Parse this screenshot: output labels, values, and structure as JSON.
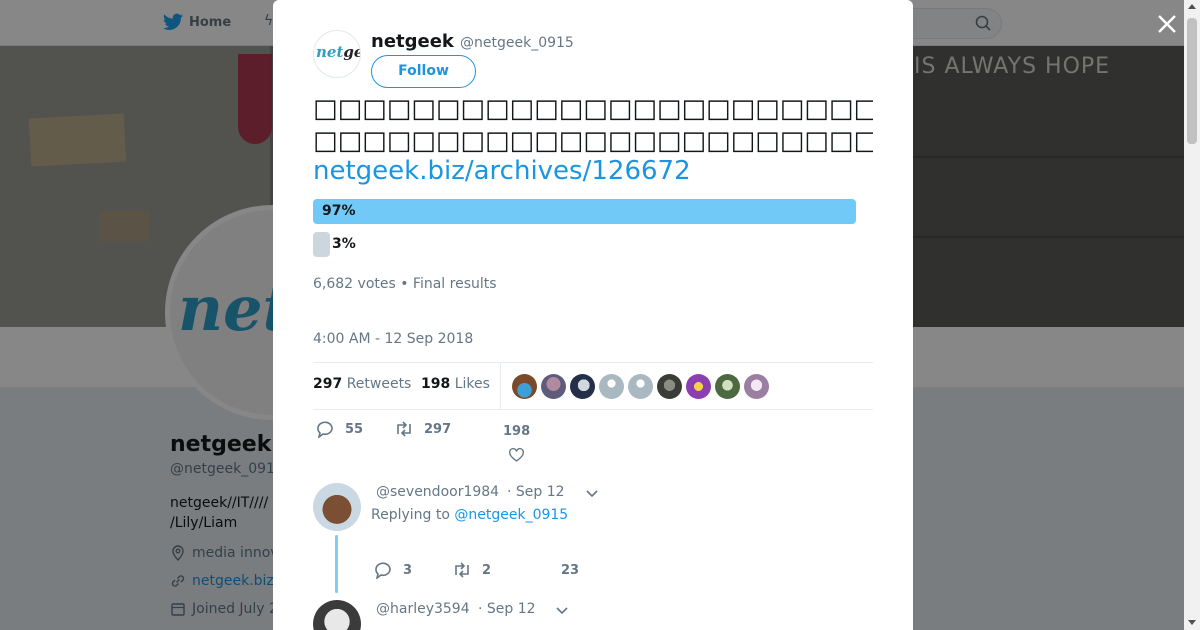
{
  "background": {
    "nav": {
      "home_label": "Home"
    },
    "banner_text": "IS ALWAYS HOPE",
    "profile": {
      "name": "netgeek",
      "handle": "@netgeek_091",
      "bio": "netgeek//IT//// /Lily/Liam",
      "location": "media innov",
      "website": "netgeek.biz",
      "joined": "Joined July 2"
    }
  },
  "tweet": {
    "author_name": "netgeek",
    "author_handle": "@netgeek_0915",
    "avatar_text": "netgeek",
    "follow_label": "Follow",
    "text_line1": "□□□□□□□□□□□□□□□□□□□□□□□",
    "text_line2": "□□□□□□□□□□□□□□□□□□□□□□□□□□□□□□□□□□",
    "link": "netgeek.biz/archives/126672",
    "poll": {
      "options": [
        {
          "label": "97%",
          "share": 0.97,
          "color": "#71c9f8"
        },
        {
          "label": "3%",
          "share": 0.03,
          "color": "#ccd6dd"
        }
      ],
      "meta": "6,682 votes • Final results"
    },
    "timestamp": "4:00 AM - 12 Sep 2018",
    "retweets_count": "297",
    "retweets_label": "Retweets",
    "likes_count": "198",
    "likes_label": "Likes",
    "actions": {
      "replies": "55",
      "retweets": "297",
      "likes": "198"
    }
  },
  "replies": [
    {
      "handle": "@sevendoor1984",
      "time": "· Sep 12",
      "replying_prefix": "Replying to",
      "replying_to": "@netgeek_0915",
      "replies": "3",
      "retweets": "2",
      "likes": "23"
    },
    {
      "handle": "@harley3594",
      "time": "· Sep 12"
    }
  ],
  "colors": {
    "accent": "#1b95e0",
    "poll_winner": "#71c9f8",
    "poll_other": "#ccd6dd",
    "thread_line": "#83cdf0"
  }
}
